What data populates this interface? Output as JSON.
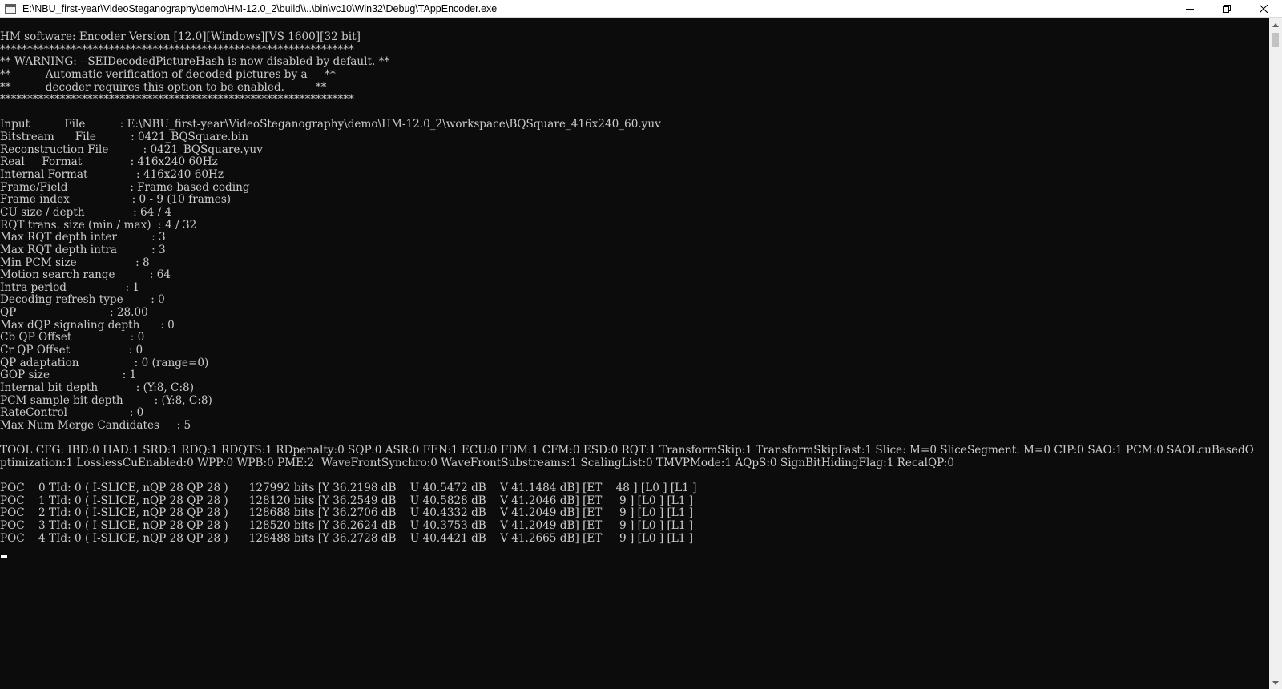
{
  "window": {
    "title": "E:\\NBU_first-year\\VideoSteganography\\demo\\HM-12.0_2\\build\\\\..\\bin\\vc10\\Win32\\Debug\\TAppEncoder.exe",
    "app_icon": "console-icon",
    "controls": {
      "minimize_icon": "minimize-icon",
      "restore_icon": "restore-icon",
      "close_icon": "close-icon"
    }
  },
  "console": {
    "lines": [
      "HM software: Encoder Version [12.0][Windows][VS 1600][32 bit]",
      "*****************************************************************",
      "** WARNING: --SEIDecodedPictureHash is now disabled by default. **",
      "**          Automatic verification of decoded pictures by a     **",
      "**          decoder requires this option to be enabled.         **",
      "*****************************************************************",
      "",
      "Input          File          : E:\\NBU_first-year\\VideoSteganography\\demo\\HM-12.0_2\\workspace\\BQSquare_416x240_60.yuv",
      "Bitstream      File          : 0421_BQSquare.bin",
      "Reconstruction File          : 0421_BQSquare.yuv",
      "Real     Format              : 416x240 60Hz",
      "Internal Format              : 416x240 60Hz",
      "Frame/Field                  : Frame based coding",
      "Frame index                  : 0 - 9 (10 frames)",
      "CU size / depth              : 64 / 4",
      "RQT trans. size (min / max)  : 4 / 32",
      "Max RQT depth inter          : 3",
      "Max RQT depth intra          : 3",
      "Min PCM size                 : 8",
      "Motion search range          : 64",
      "Intra period                 : 1",
      "Decoding refresh type        : 0",
      "QP                           : 28.00",
      "Max dQP signaling depth      : 0",
      "Cb QP Offset                 : 0",
      "Cr QP Offset                 : 0",
      "QP adaptation                : 0 (range=0)",
      "GOP size                     : 1",
      "Internal bit depth           : (Y:8, C:8)",
      "PCM sample bit depth         : (Y:8, C:8)",
      "RateControl                  : 0",
      "Max Num Merge Candidates     : 5",
      "",
      "TOOL CFG: IBD:0 HAD:1 SRD:1 RDQ:1 RDQTS:1 RDpenalty:0 SQP:0 ASR:0 FEN:1 ECU:0 FDM:1 CFM:0 ESD:0 RQT:1 TransformSkip:1 TransformSkipFast:1 Slice: M=0 SliceSegment: M=0 CIP:0 SAO:1 PCM:0 SAOLcuBasedO",
      "ptimization:1 LosslessCuEnabled:0 WPP:0 WPB:0 PME:2  WaveFrontSynchro:0 WaveFrontSubstreams:1 ScalingList:0 TMVPMode:1 AQpS:0 SignBitHidingFlag:1 RecalQP:0",
      "",
      "POC    0 TId: 0 ( I-SLICE, nQP 28 QP 28 )      127992 bits [Y 36.2198 dB    U 40.5472 dB    V 41.1484 dB] [ET    48 ] [L0 ] [L1 ]",
      "POC    1 TId: 0 ( I-SLICE, nQP 28 QP 28 )      128120 bits [Y 36.2549 dB    U 40.5828 dB    V 41.2046 dB] [ET     9 ] [L0 ] [L1 ]",
      "POC    2 TId: 0 ( I-SLICE, nQP 28 QP 28 )      128688 bits [Y 36.2706 dB    U 40.4332 dB    V 41.2049 dB] [ET     9 ] [L0 ] [L1 ]",
      "POC    3 TId: 0 ( I-SLICE, nQP 28 QP 28 )      128520 bits [Y 36.2624 dB    U 40.3753 dB    V 41.2049 dB] [ET     9 ] [L0 ] [L1 ]",
      "POC    4 TId: 0 ( I-SLICE, nQP 28 QP 28 )      128488 bits [Y 36.2728 dB    U 40.4421 dB    V 41.2665 dB] [ET     9 ] [L0 ] [L1 ]"
    ]
  },
  "colors": {
    "console_background": "#0c0c0c",
    "console_text": "#cccccc",
    "titlebar_background": "#ffffff"
  }
}
